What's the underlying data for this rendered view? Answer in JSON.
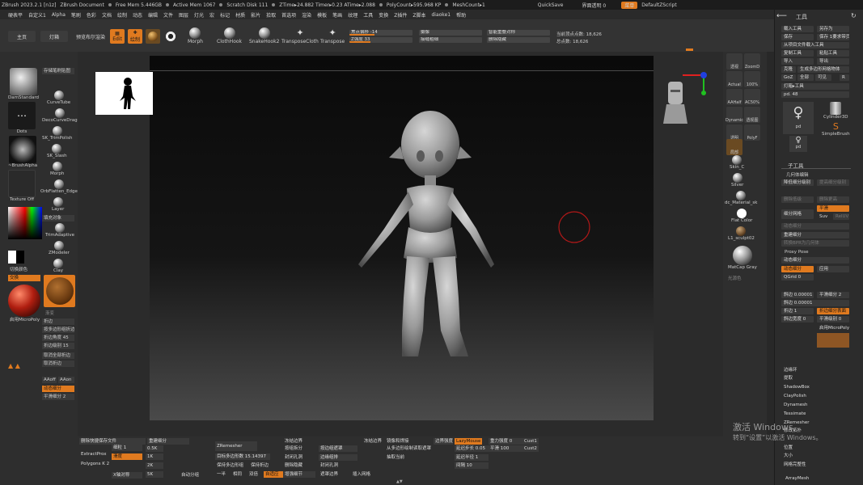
{
  "titlebar": {
    "app": "ZBrush 2023.2.1 [n1z]",
    "doc": "ZBrush Document",
    "free_mem": "Free Mem 5.446GB",
    "active_mem": "Active Mem 1067",
    "scratch": "Scratch Disk 111",
    "ztime": "ZTime▸24.882 Timer▸0.23 ATime▸2.088",
    "polycount": "PolyCount▸595.968 KP",
    "meshcount": "MeshCount▸1",
    "quicksave": "QuickSave",
    "ui_transparency": "界面透明 0",
    "menu_chip": "菜单",
    "default_script": "DefaultZScript"
  },
  "menubar": {
    "items": [
      "硬表平",
      "自定义1",
      "Alpha",
      "笔刷",
      "色彩",
      "文档",
      "绘制",
      "动态",
      "编辑",
      "文件",
      "图层",
      "灯光",
      "宏",
      "标记",
      "材质",
      "影片",
      "拾取",
      "首选项",
      "渲染",
      "模板",
      "笔画",
      "纹理",
      "工具",
      "变换",
      "Z插件",
      "Z脚本",
      "diaoke1",
      "帮助"
    ]
  },
  "toolbar": {
    "home": "主页",
    "lightbox": "灯箱",
    "preview_render": "预览布尔渲染",
    "edit": "Edit",
    "draw": "绘制",
    "move": "移动",
    "scale": "缩放",
    "rotate": "旋转",
    "tools": [
      "Morph",
      "ClothHook",
      "SnakeHook2",
      "TransposeCloth",
      "Transpose"
    ],
    "focal_shift_label": "焦点偏移 -14",
    "z_intensity_label": "Z强度 33",
    "camera": "摄像",
    "thickness": "接缝粗细",
    "smart_sym": "智能重叠对称",
    "delete_hidden": "删除隐藏",
    "current_points": "当前顶点点数: 18,626",
    "total_points": "总点数: 18,626"
  },
  "leftshelf": {
    "brushes": [
      "DamStandard",
      "CurveTube",
      "DecoCurveDrag",
      "SK_TrimPolish",
      "SK_Slash",
      "Morph",
      "OrbFlatten_Edge",
      "Layer",
      "TrimAdaptive",
      "ZModeler",
      "Clay"
    ],
    "stroke_dots": "Dots",
    "alpha": "~BrushAlpha",
    "texture_off": "Texture Off",
    "save_brush": "存储笔刷贴图",
    "fill_object": "填充对象",
    "switch_color": "切换颜色",
    "swap": "交换",
    "gradient": "渐变",
    "fold": "折边",
    "micropoly": "启用MicroPoly",
    "merge_fold": "按多边形组折边",
    "fold_angle": "折边角度 45",
    "fold_level": "折边级别 15",
    "cancel_fold": "取消全部折边",
    "cancel_fold2": "取消折边",
    "aaoff": "AAoff",
    "aaon": "AAon",
    "dynamic_sub": "动态细分",
    "smooth_sub": "平滑细分 2"
  },
  "viewport": {
    "accent": "#e07a1f",
    "brush_ring_color": "#b01818"
  },
  "rightstrip": {
    "buttons": [
      "透视",
      "ZoomD",
      "Actual",
      "AAHalf",
      "Dynamic",
      "透视图",
      "透明",
      "PolyF",
      "局部"
    ],
    "zoom_label": "100%",
    "ac_label": "AC50%",
    "materials": [
      "Skin_C",
      "Silver",
      "dc_Material_sk",
      "Flat Color",
      "L1_sculpt02",
      "MatCap Gray"
    ],
    "color_hint": "光源色"
  },
  "toolpanel": {
    "title": "工具",
    "load_tool": "载入工具",
    "save_as": "另存为",
    "save": "保存",
    "save2": "保存 1要求带页 1",
    "load_from_proj": "从项目文件载入工具",
    "copy_tool": "复制工具",
    "paste_tool": "粘贴工具",
    "import": "导入",
    "export": "导出",
    "clone": "克隆",
    "make_polymesh": "生成多边形网格物体",
    "goz": "GoZ",
    "all": "全部",
    "visible": "可见",
    "r": "R",
    "lightbox_tool": "灯箱▸工具",
    "pd_value": "pd. 48",
    "tools": [
      "pd",
      "Cylinder3D",
      "SimpleBrush",
      "pd"
    ],
    "subtool": "子工具",
    "geometry": "几何体编辑",
    "lower_res": "降低细分级别",
    "higher_res": "提高细分级别",
    "del_lower": "删除低级",
    "del_higher": "删除更高",
    "divide": "细分网格",
    "smooth": "平滑",
    "suv": "Suv",
    "reluv": "RelUV",
    "dynamic_sub": "动态细分",
    "reconstruct": "重建细分",
    "convert_bpr": "转换BPR为几何体",
    "proxy_pose": "Proxy Pose",
    "dynamic_sub2": "动态细分",
    "apply": "应用",
    "qgrid": "QGrid 0",
    "smooth_sub": "平滑细分 2",
    "bevel": "斜边 0.00001",
    "fold_sub": "折边 1",
    "fold_sub_surface": "折边细分表面",
    "bevel_width": "斜边宽度 0",
    "smooth_lvl": "平滑级别 0",
    "micropoly": "启用MicroPoly",
    "items": [
      "边缘环",
      "提取",
      "ShadowBox",
      "ClayPolish",
      "Dynamesh",
      "Tessimate",
      "ZRemesher",
      "修改拓扑",
      "位置",
      "大小",
      "网格完整性"
    ],
    "arraymesh": "ArrayMesh"
  },
  "bottomshelf": {
    "del_save": "删除快捷保存文件",
    "rebuild": "重建细分",
    "zremesher": "ZRemesher",
    "target_poly": "目标多边形数 15.14397",
    "keep_groups": "保持多边形组",
    "keep_fold": "保持折边",
    "fill_edge": "冻结边界",
    "group_by": "按组拆分",
    "close_holes": "封闭孔洞",
    "extract": "ExtractProx",
    "polygons": "Polygons K 2",
    "res_1": "细粒 1",
    "res_05k": "0.5K",
    "res_1k": "1K",
    "res_2k": "2K",
    "res_5k": "5K",
    "smooth": "滑度",
    "x_symmetry": "X轴对称",
    "auto_group": "自动分组",
    "half": "一半",
    "same": "相同",
    "double": "双倍",
    "adaptive": "自适应",
    "freeze_edges": "冻结边界",
    "mask_by_poly": "按边组遮罩",
    "polish_groups": "边缘组排",
    "lazy_mouse": "LazyMouse",
    "lazy_step": "延迟步长 0.05",
    "lazy_radius": "延迟半径 1",
    "gravity": "重力强度 0",
    "smooth_val": "平滑 100",
    "cust1": "Cust1",
    "cust2": "Cust2",
    "delete_hidden": "删除隐藏",
    "close_holes2": "封闭孔洞",
    "mirror_weld": "镜像和焊接",
    "extract_stroke": "抽取当前",
    "stroke_10": "间隔 10",
    "from_polypaint": "从多边形绘制读取遮罩",
    "masking_edges": "遮罩边界",
    "strength": "增强细节",
    "grow": "插入网格",
    "gravity2": "边界强度 0"
  },
  "watermark": {
    "line1": "激活 Windows",
    "line2": "转到“设置”以激活 Windows。"
  }
}
